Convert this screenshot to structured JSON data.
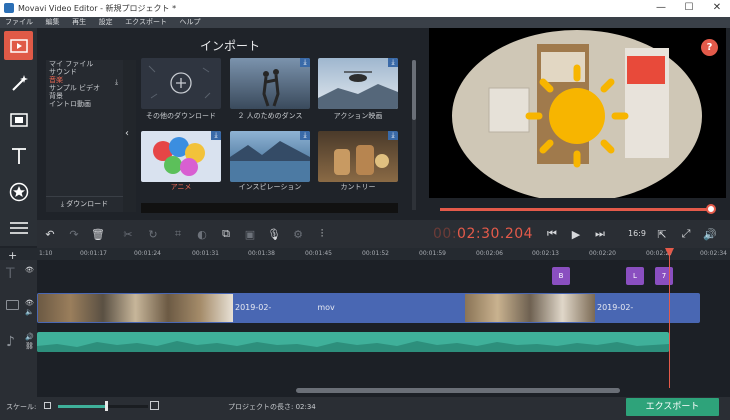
{
  "window": {
    "title": "Movavi Video Editor - 新規プロジェクト *",
    "minimize": "—",
    "maximize": "☐",
    "close": "✕"
  },
  "menu": [
    "ファイル",
    "編集",
    "再生",
    "設定",
    "エクスポート",
    "ヘルプ"
  ],
  "import": {
    "title": "インポート",
    "categories": [
      {
        "label": "マイ ファイル"
      },
      {
        "label": "サウンド"
      },
      {
        "label": "音楽"
      },
      {
        "label": "サンプル ビデオ"
      },
      {
        "label": "背景"
      },
      {
        "label": "イントロ動画"
      }
    ],
    "selected_category": 2,
    "download_button": "ダウンロード",
    "thumbnails": [
      {
        "label": "その他のダウンロード"
      },
      {
        "label": "２ 人のためのダンス"
      },
      {
        "label": "アクション映画"
      },
      {
        "label": "アニメ"
      },
      {
        "label": "インスピレーション"
      },
      {
        "label": "カントリー"
      }
    ]
  },
  "player": {
    "timecode_dim": "00:",
    "timecode_main": "02:30.204",
    "aspect": "16:9"
  },
  "ruler": [
    "1:10",
    "00:01:17",
    "00:01:24",
    "00:01:31",
    "00:01:38",
    "00:01:45",
    "00:01:52",
    "00:01:59",
    "00:02:06",
    "00:02:13",
    "00:02:20",
    "00:02:27",
    "00:02:34"
  ],
  "timeline": {
    "clip1_label": "2019-02-",
    "clip1_suffix": "mov",
    "clip2_label": "2019-02-",
    "fx": [
      "B",
      "L",
      "7"
    ]
  },
  "status": {
    "scale_label": "スケール:",
    "project_length": "プロジェクトの長さ: 02:34",
    "export_button": "エクスポート"
  },
  "colors": {
    "accent": "#e45a4a",
    "video_track": "#4967b3",
    "audio_track": "#3fb09a",
    "export": "#2ea37a"
  }
}
